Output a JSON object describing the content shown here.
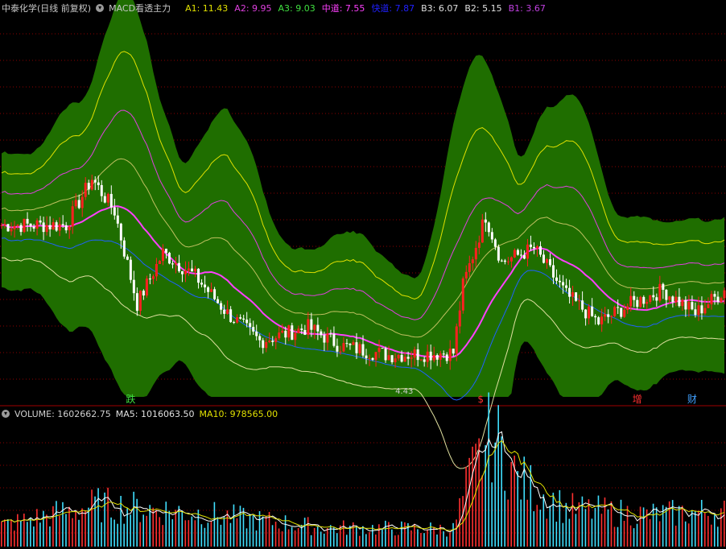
{
  "header": {
    "stock": "中泰化学(日线 前复权)",
    "indicator": "MACD看透主力",
    "values": [
      {
        "label": "A1:",
        "value": "11.43",
        "color": "#e0e000"
      },
      {
        "label": "A2:",
        "value": "9.95",
        "color": "#e040e0"
      },
      {
        "label": "A3:",
        "value": "9.03",
        "color": "#40e040"
      },
      {
        "label": "中道:",
        "value": "7.55",
        "color": "#ff40ff"
      },
      {
        "label": "快道:",
        "value": "7.87",
        "color": "#2020ff"
      },
      {
        "label": "B3:",
        "value": "6.07",
        "color": "#e0e0e0"
      },
      {
        "label": "B2:",
        "value": "5.15",
        "color": "#e0e0e0"
      },
      {
        "label": "B1:",
        "value": "3.67",
        "color": "#c040e0"
      }
    ]
  },
  "volume_header": {
    "volume": "VOLUME: 1602662.75",
    "ma5": "MA5: 1016063.50",
    "ma10": "MA10: 978565.00"
  },
  "markers": [
    {
      "text": "跌",
      "color": "#40e040",
      "index": 40
    },
    {
      "text": "$",
      "color": "#ff3030",
      "index": 149
    },
    {
      "text": "增",
      "color": "#ff3030",
      "index": 197
    },
    {
      "text": "财",
      "color": "#40a0ff",
      "index": 214
    }
  ],
  "price_label": "4.43",
  "colors": {
    "up": "#ff2020",
    "down": "#ffffff",
    "band_fill": "#1f6e00",
    "upper_line": "#e0e000",
    "upper2_line": "#e040e0",
    "mid_line": "#ff40ff",
    "fast_line": "#2060ff",
    "lower_line": "#e0e0a0",
    "grid": "#8b0000"
  },
  "chart_data": [
    {
      "type": "candlestick",
      "title": "",
      "series": [
        "A1",
        "A2",
        "A3",
        "中道",
        "快道",
        "B3",
        "B2",
        "B1"
      ],
      "x_count": 225,
      "price_range": [
        3.6,
        11.8
      ],
      "last_values": {
        "A1": 11.43,
        "A2": 9.95,
        "A3": 9.03,
        "中道": 7.55,
        "快道": 7.87,
        "B3": 6.07,
        "B2": 5.15,
        "B1": 3.67
      },
      "annotated_low": 4.43,
      "price_keypoints": [
        {
          "i": 0,
          "p": 7.3
        },
        {
          "i": 20,
          "p": 7.3
        },
        {
          "i": 28,
          "p": 8.3
        },
        {
          "i": 35,
          "p": 7.6
        },
        {
          "i": 42,
          "p": 5.6
        },
        {
          "i": 50,
          "p": 6.7
        },
        {
          "i": 60,
          "p": 6.2
        },
        {
          "i": 70,
          "p": 5.4
        },
        {
          "i": 80,
          "p": 4.8
        },
        {
          "i": 95,
          "p": 5.1
        },
        {
          "i": 105,
          "p": 4.7
        },
        {
          "i": 120,
          "p": 4.5
        },
        {
          "i": 140,
          "p": 4.55
        },
        {
          "i": 143,
          "p": 6.0
        },
        {
          "i": 150,
          "p": 7.5
        },
        {
          "i": 155,
          "p": 6.5
        },
        {
          "i": 165,
          "p": 6.8
        },
        {
          "i": 175,
          "p": 5.8
        },
        {
          "i": 185,
          "p": 5.2
        },
        {
          "i": 195,
          "p": 5.6
        },
        {
          "i": 205,
          "p": 5.9
        },
        {
          "i": 215,
          "p": 5.4
        },
        {
          "i": 224,
          "p": 5.9
        }
      ]
    },
    {
      "type": "bar",
      "title": "",
      "series": [
        "VOLUME",
        "MA5",
        "MA10"
      ],
      "last_values": {
        "VOLUME": 1602662.75,
        "MA5": 1016063.5,
        "MA10": 978565.0
      },
      "vol_range": [
        0,
        3000000
      ],
      "vol_keypoints": [
        {
          "i": 0,
          "v": 500000
        },
        {
          "i": 30,
          "v": 1000000
        },
        {
          "i": 60,
          "v": 800000
        },
        {
          "i": 100,
          "v": 450000
        },
        {
          "i": 140,
          "v": 420000
        },
        {
          "i": 145,
          "v": 1600000
        },
        {
          "i": 152,
          "v": 2700000
        },
        {
          "i": 160,
          "v": 1600000
        },
        {
          "i": 175,
          "v": 900000
        },
        {
          "i": 200,
          "v": 750000
        },
        {
          "i": 224,
          "v": 850000
        }
      ]
    }
  ]
}
